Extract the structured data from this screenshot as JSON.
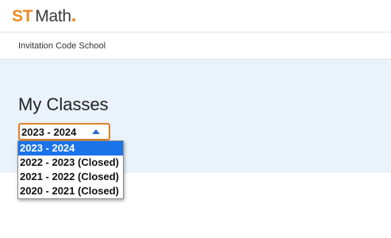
{
  "header": {
    "logo_st": "ST",
    "logo_math": "Math"
  },
  "school": {
    "name": "Invitation Code School"
  },
  "main": {
    "title": "My Classes",
    "year_select": {
      "value": "2023 - 2024",
      "options": [
        {
          "label": "2023 - 2024",
          "selected": true
        },
        {
          "label": "2022 - 2023 (Closed)",
          "selected": false
        },
        {
          "label": "2021 - 2022 (Closed)",
          "selected": false
        },
        {
          "label": "2020 - 2021 (Closed)",
          "selected": false
        }
      ]
    }
  },
  "colors": {
    "brand_orange": "#f08a24",
    "content_background": "#eaf2fb",
    "selected_option": "#1a73e8",
    "select_border": "#d9822b",
    "caret": "#2a6fc9"
  },
  "icons": {
    "dropdown_caret": "caret-up-icon"
  }
}
